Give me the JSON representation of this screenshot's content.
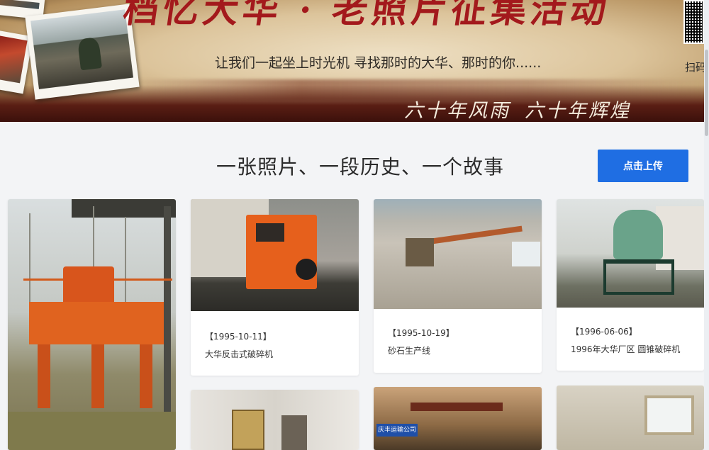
{
  "banner": {
    "title": "档忆大华 · 老照片征集活动",
    "subtitle": "让我们一起坐上时光机    寻找那时的大华、那时的你......",
    "slogans": [
      "六十年风雨",
      "六十年辉煌"
    ],
    "qr_label": "扫码"
  },
  "section": {
    "title": "一张照片、一段历史、一个故事",
    "upload_label": "点击上传"
  },
  "cards": [
    {
      "date": "",
      "caption": ""
    },
    {
      "date": "【1995-10-11】",
      "caption": "大华反击式破碎机"
    },
    {
      "date": "【1995-10-19】",
      "caption": "砂石生产线"
    },
    {
      "date": "【1996-06-06】",
      "caption": "1996年大华厂区 圆锥破碎机"
    },
    {
      "date": "",
      "caption": ""
    },
    {
      "date": "",
      "caption": "",
      "photo_text": "庆丰运输公司"
    },
    {
      "date": "",
      "caption": ""
    }
  ],
  "colors": {
    "accent": "#1f6ee3",
    "banner_title": "#a3191c",
    "page_bg": "#f3f4f6"
  }
}
